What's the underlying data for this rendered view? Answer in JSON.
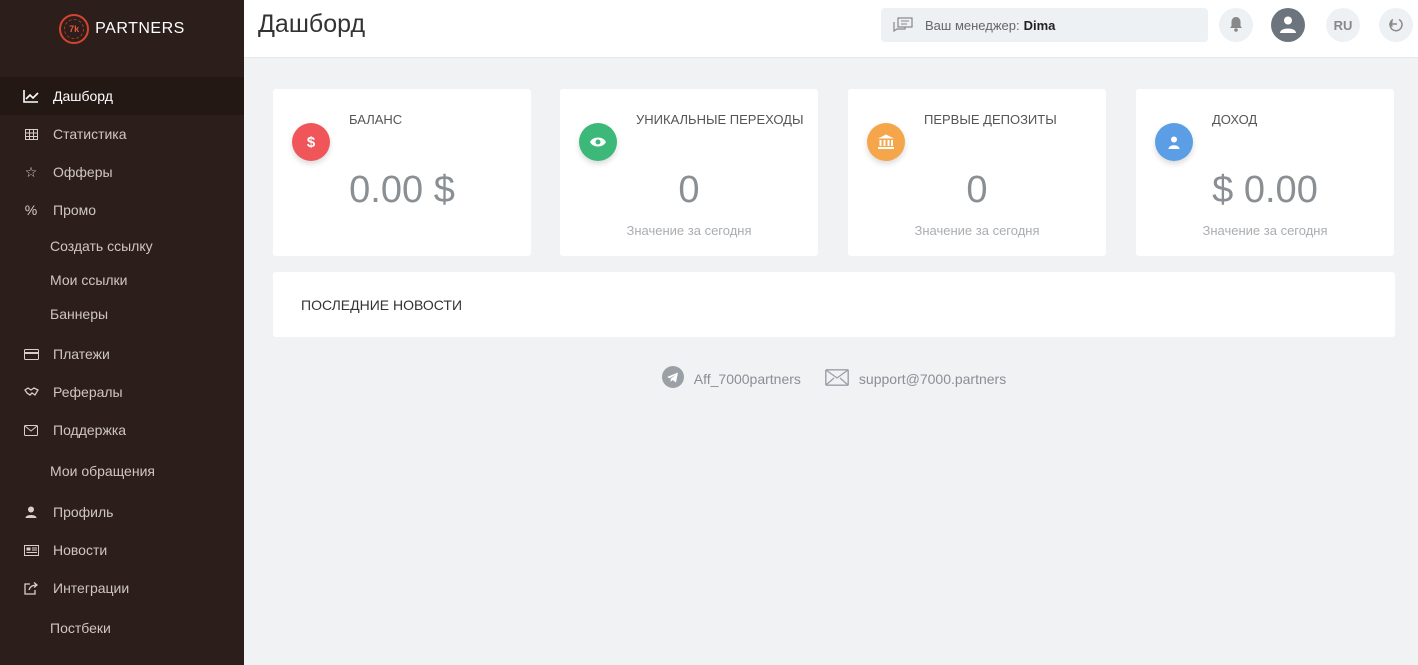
{
  "brand": {
    "name": "PARTNERS",
    "mark_text": "7k",
    "accent": "#d2452f"
  },
  "sidebar": {
    "items": [
      {
        "label": "Дашборд",
        "icon": "chart-line-icon",
        "active": true
      },
      {
        "label": "Статистика",
        "icon": "table-icon"
      },
      {
        "label": "Офферы",
        "icon": "star-icon"
      },
      {
        "label": "Промо",
        "icon": "percent-icon"
      },
      {
        "label": "Создать ссылку",
        "sub": true
      },
      {
        "label": "Мои ссылки",
        "sub": true
      },
      {
        "label": "Баннеры",
        "sub": true
      },
      {
        "label": "Платежи",
        "icon": "credit-card-icon"
      },
      {
        "label": "Рефералы",
        "icon": "handshake-icon"
      },
      {
        "label": "Поддержка",
        "icon": "envelope-icon"
      },
      {
        "label": "Мои обращения",
        "sub": true
      },
      {
        "label": "Профиль",
        "icon": "user-icon"
      },
      {
        "label": "Новости",
        "icon": "newspaper-icon"
      },
      {
        "label": "Интеграции",
        "icon": "share-icon"
      },
      {
        "label": "Постбеки",
        "sub": true
      }
    ]
  },
  "header": {
    "title": "Дашборд",
    "manager_label": "Ваш менеджер:",
    "manager_name": "Dima",
    "language": "RU"
  },
  "cards": [
    {
      "title": "Баланс",
      "value": "0.00 $",
      "sub": "",
      "icon": "dollar-icon",
      "color": "#f0555a"
    },
    {
      "title": "Уникальные переходы",
      "value": "0",
      "sub": "Значение за сегодня",
      "icon": "eye-icon",
      "color": "#3cb878"
    },
    {
      "title": "Первые депозиты",
      "value": "0",
      "sub": "Значение за сегодня",
      "icon": "bank-icon",
      "color": "#f5a54a"
    },
    {
      "title": "Доход",
      "value": "$ 0.00",
      "sub": "Значение за сегодня",
      "icon": "user-icon",
      "color": "#5b9ee6"
    }
  ],
  "news": {
    "title": "ПОСЛЕДНИЕ НОВОСТИ"
  },
  "contacts": {
    "telegram": "Aff_7000partners",
    "email": "support@7000.partners"
  }
}
